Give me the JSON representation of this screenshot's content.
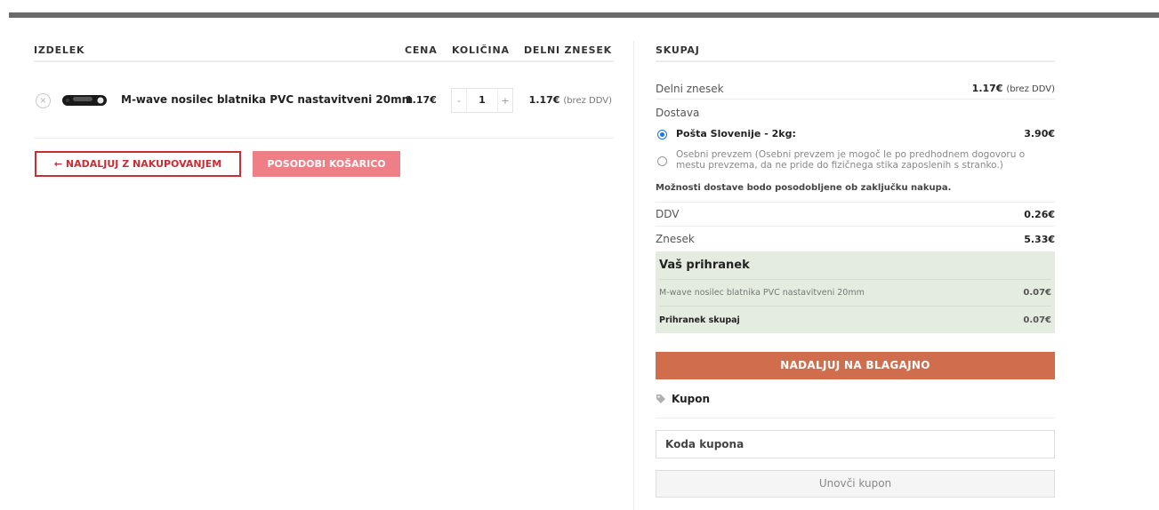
{
  "cart": {
    "headers": {
      "product": "IZDELEK",
      "price": "CENA",
      "quantity": "KOLIČINA",
      "subtotal": "DELNI ZNESEK"
    },
    "items": [
      {
        "remove": "×",
        "name": "M-wave nosilec blatnika PVC nastavitveni 20mm",
        "price": "1.17€",
        "qty_minus": "-",
        "qty": "1",
        "qty_plus": "+",
        "subtotal": "1.17€",
        "subtotal_tax": "(brez DDV)"
      }
    ],
    "continue_label": "← NADALJUJ Z NAKUPOVANJEM",
    "update_label": "POSODOBI KOŠARICO"
  },
  "totals": {
    "title": "SKUPAJ",
    "subtotal_label": "Delni znesek",
    "subtotal_value": "1.17€",
    "subtotal_tax": "(brez DDV)",
    "shipping_label": "Dostava",
    "shipping_options": [
      {
        "label": "Pošta Slovenije - 2kg:",
        "price": "3.90€",
        "selected": true
      },
      {
        "label": "Osebni prevzem (Osebni prevzem je mogoč le po predhodnem dogovoru o mestu prevzema, da ne pride do fizičnega stika zaposlenih s stranko.)",
        "selected": false
      }
    ],
    "shipping_note": "Možnosti dostave bodo posodobljene ob zaključku nakupa.",
    "vat_label": "DDV",
    "vat_value": "0.26€",
    "total_label": "Znesek",
    "total_value": "5.33€",
    "savings": {
      "title": "Vaš prihranek",
      "items": [
        {
          "name": "M-wave nosilec blatnika PVC nastavitveni 20mm",
          "value": "0.07€"
        }
      ],
      "total_label": "Prihranek skupaj",
      "total_value": "0.07€"
    },
    "checkout_label": "NADALJUJ NA BLAGAJNO"
  },
  "coupon": {
    "title": "Kupon",
    "placeholder": "Koda kupona",
    "apply_label": "Unovči kupon"
  },
  "colors": {
    "accent_red": "#c82c34",
    "update_pink": "#ee7f86",
    "checkout_orange": "#d06d4c",
    "savings_bg": "#e3ecdf",
    "radio_blue": "#1a73e8"
  },
  "icons": {
    "remove": "close-icon",
    "coupon": "tag-icon"
  }
}
